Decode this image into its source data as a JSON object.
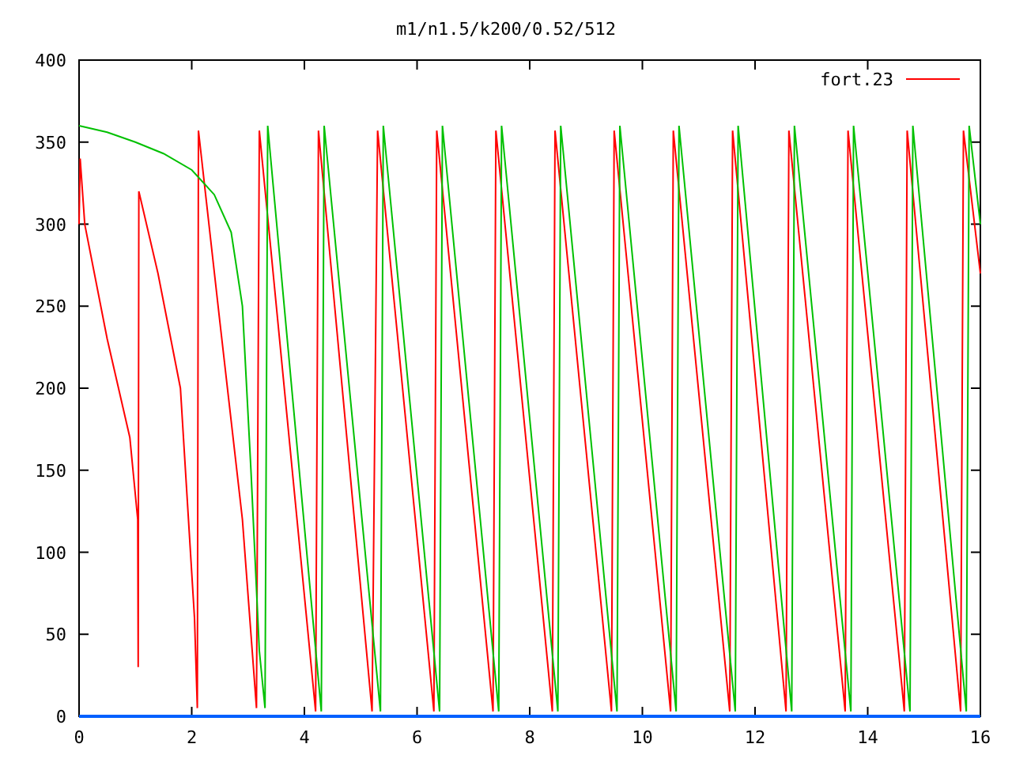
{
  "chart_data": {
    "type": "line",
    "title": "m1/n1.5/k200/0.52/512",
    "xlim": [
      0,
      16
    ],
    "ylim": [
      0,
      400
    ],
    "xticks": [
      0,
      2,
      4,
      6,
      8,
      10,
      12,
      14,
      16
    ],
    "yticks": [
      0,
      50,
      100,
      150,
      200,
      250,
      300,
      350,
      400
    ],
    "series": [
      {
        "name": "fort.23",
        "color": "#ff0000",
        "x": [
          0,
          0.02,
          0.1,
          0.5,
          0.9,
          1.04,
          1.05,
          1.06,
          1.4,
          1.8,
          2.05,
          2.1,
          2.12,
          2.5,
          2.9,
          3.15,
          3.2,
          4.2,
          4.25,
          5.2,
          5.3,
          6.3,
          6.35,
          7.35,
          7.4,
          8.4,
          8.45,
          9.45,
          9.5,
          10.5,
          10.55,
          11.55,
          11.6,
          12.55,
          12.6,
          13.6,
          13.65,
          14.65,
          14.7,
          15.65,
          15.7,
          16
        ],
        "values": [
          300,
          340,
          300,
          230,
          170,
          120,
          30,
          320,
          270,
          200,
          60,
          5,
          357,
          240,
          120,
          5,
          357,
          3,
          357,
          3,
          357,
          3,
          357,
          3,
          357,
          3,
          357,
          3,
          357,
          3,
          357,
          3,
          357,
          3,
          357,
          3,
          357,
          3,
          357,
          3,
          357,
          270
        ]
      },
      {
        "color": "#00c000",
        "x": [
          0,
          0.5,
          1,
          1.5,
          2,
          2.4,
          2.7,
          2.9,
          3.05,
          3.2,
          3.3,
          3.35,
          4.3,
          4.35,
          5.35,
          5.4,
          6.4,
          6.45,
          7.45,
          7.5,
          8.5,
          8.55,
          9.55,
          9.6,
          10.6,
          10.65,
          11.65,
          11.7,
          12.65,
          12.7,
          13.7,
          13.75,
          14.75,
          14.8,
          15.75,
          15.8,
          16
        ],
        "values": [
          360,
          356,
          350,
          343,
          333,
          318,
          295,
          250,
          150,
          40,
          5,
          360,
          3,
          360,
          3,
          360,
          3,
          360,
          3,
          360,
          3,
          360,
          3,
          360,
          3,
          360,
          3,
          360,
          3,
          360,
          3,
          360,
          3,
          360,
          3,
          360,
          300
        ]
      },
      {
        "color": "#0060ff",
        "x": [
          0,
          16
        ],
        "values": [
          0,
          0
        ]
      }
    ]
  }
}
